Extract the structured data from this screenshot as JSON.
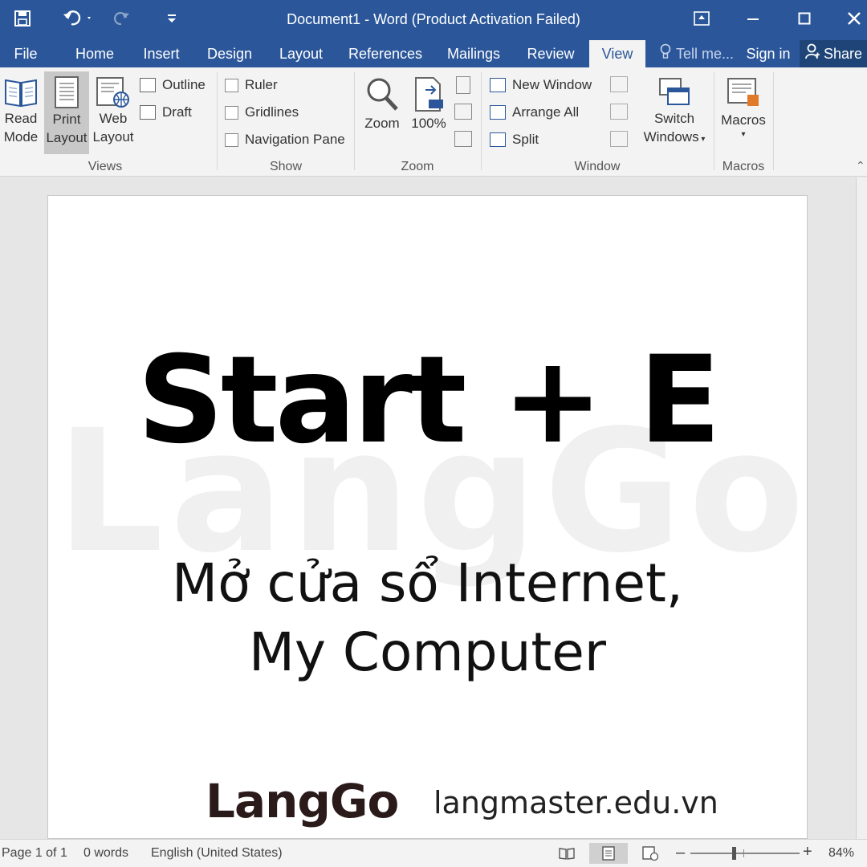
{
  "window": {
    "title": "Document1 - Word (Product Activation Failed)"
  },
  "tabs": [
    {
      "label": "File"
    },
    {
      "label": "Home"
    },
    {
      "label": "Insert"
    },
    {
      "label": "Design"
    },
    {
      "label": "Layout"
    },
    {
      "label": "References"
    },
    {
      "label": "Mailings"
    },
    {
      "label": "Review"
    },
    {
      "label": "View"
    }
  ],
  "tabbar": {
    "tell_me": "Tell me...",
    "sign_in": "Sign in",
    "share": "Share"
  },
  "ribbon": {
    "views": {
      "label": "Views",
      "read_mode": [
        "Read",
        "Mode"
      ],
      "print_layout": [
        "Print",
        "Layout"
      ],
      "web_layout": [
        "Web",
        "Layout"
      ],
      "outline": "Outline",
      "draft": "Draft"
    },
    "show": {
      "label": "Show",
      "ruler": "Ruler",
      "gridlines": "Gridlines",
      "navigation_pane": "Navigation Pane"
    },
    "zoom": {
      "label": "Zoom",
      "zoom": "Zoom",
      "hundred": "100%"
    },
    "window": {
      "label": "Window",
      "new_window": "New Window",
      "arrange_all": "Arrange All",
      "split": "Split",
      "switch_windows": [
        "Switch",
        "Windows"
      ]
    },
    "macros": {
      "label": "Macros",
      "macros": "Macros"
    }
  },
  "document": {
    "headline": "Start + E",
    "line1": "Mở cửa sổ Internet,",
    "line2": "My Computer",
    "watermark": "LangGo",
    "brand": "LangGo",
    "website": "langmaster.edu.vn"
  },
  "status": {
    "page": "Page 1 of 1",
    "words": "0 words",
    "language": "English (United States)",
    "zoom": "84%",
    "zoom_level": 0.84
  },
  "colors": {
    "accent": "#2b579a"
  }
}
